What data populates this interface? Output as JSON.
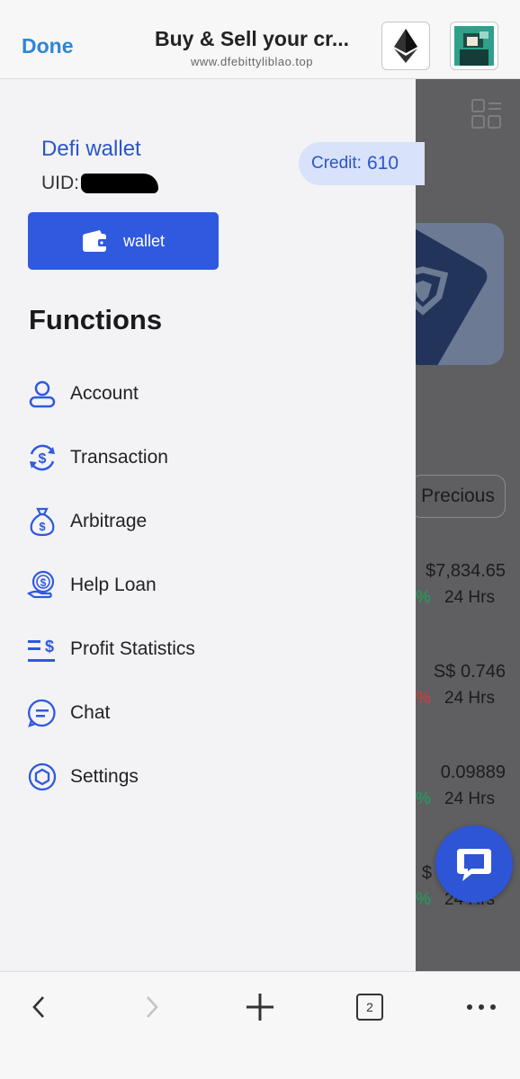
{
  "browser": {
    "done_label": "Done",
    "title": "Buy & Sell your cr...",
    "url": "www.dfebittyliblao.top",
    "tab_count": "2",
    "icons": {
      "eth": "ethereum-icon",
      "back": "back-arrow-icon",
      "forward": "forward-arrow-icon",
      "new_tab": "plus-icon",
      "tabs": "tabs-icon",
      "more": "more-icon"
    }
  },
  "drawer": {
    "wallet_name": "Defi wallet",
    "uid_label": "UID:",
    "credit_label": "Credit:",
    "credit_value": "610",
    "wallet_button": "wallet",
    "functions_title": "Functions",
    "menu": [
      {
        "label": "Account",
        "icon": "user-icon"
      },
      {
        "label": "Transaction",
        "icon": "dollar-exchange-icon"
      },
      {
        "label": "Arbitrage",
        "icon": "money-bag-icon"
      },
      {
        "label": "Help Loan",
        "icon": "coin-hand-icon"
      },
      {
        "label": "Profit Statistics",
        "icon": "statistics-icon"
      },
      {
        "label": "Chat",
        "icon": "chat-icon"
      },
      {
        "label": "Settings",
        "icon": "settings-hexagon-icon"
      }
    ]
  },
  "background": {
    "tab_precious": "Precious",
    "rows": [
      {
        "price": "$7,834.65",
        "pct": "%",
        "period": "24 Hrs",
        "trend": "up"
      },
      {
        "price": "S$ 0.746",
        "pct": "%",
        "period": "24 Hrs",
        "trend": "down"
      },
      {
        "price": "0.09889",
        "pct": "%",
        "period": "24 Hrs",
        "trend": "up"
      },
      {
        "price": "$",
        "pct": "%",
        "period": "24 Hrs",
        "trend": "up"
      }
    ]
  },
  "colors": {
    "accent": "#2f59df",
    "link": "#2f86d6",
    "up": "#1aa35a",
    "down": "#d83a3a"
  }
}
